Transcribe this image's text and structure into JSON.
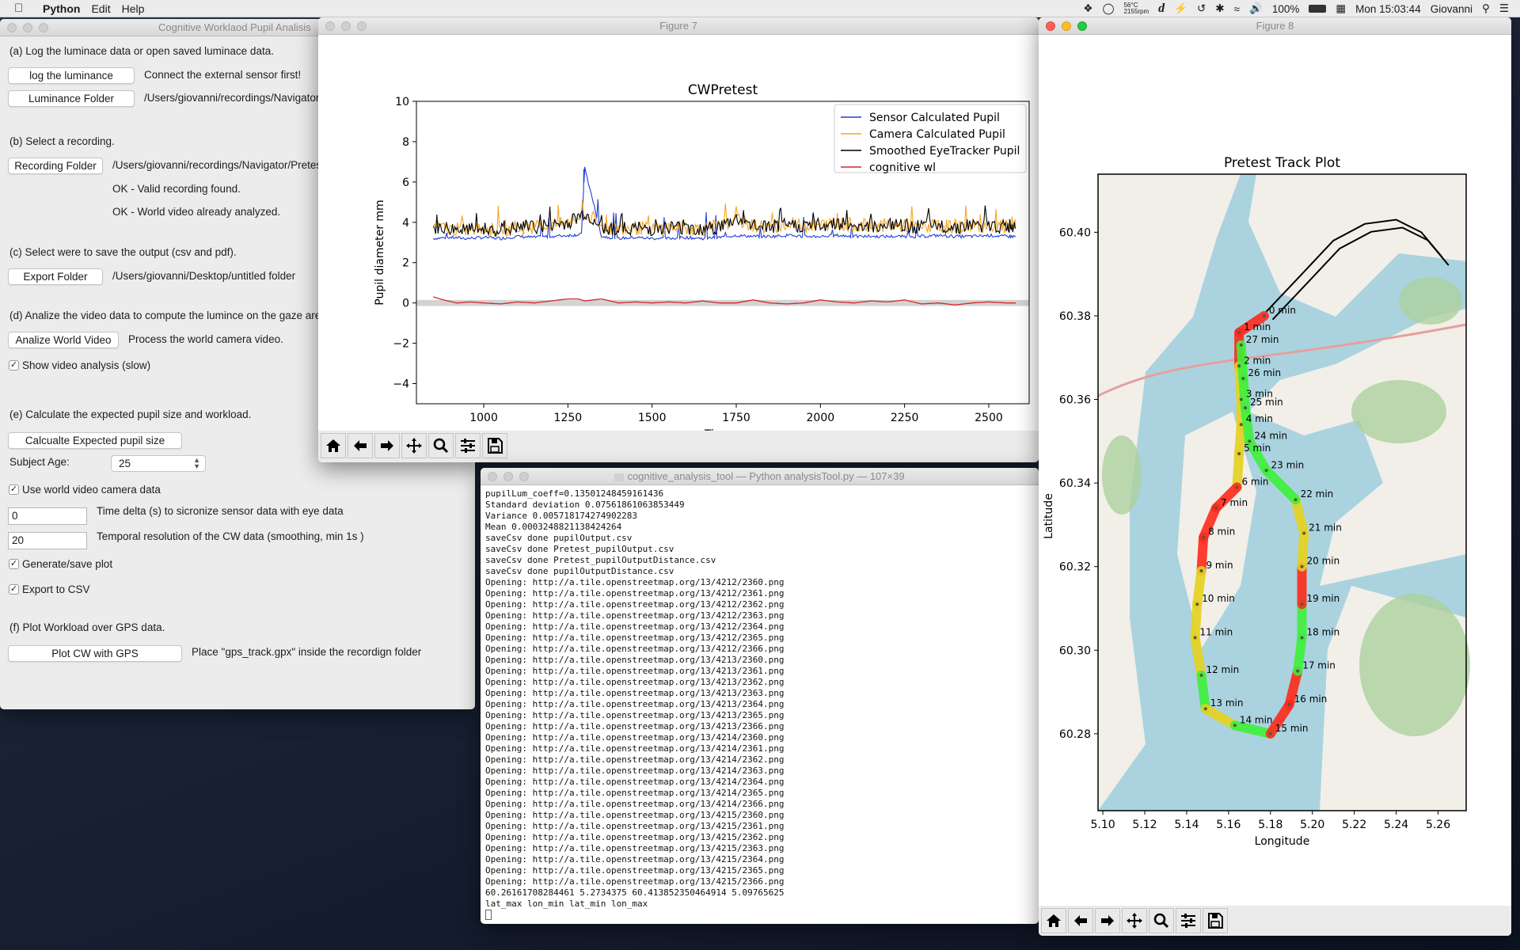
{
  "menubar": {
    "app": "Python",
    "items": [
      "Edit",
      "Help"
    ],
    "status": {
      "temp": "56°C",
      "rpm": "2155rpm",
      "battery": "100%",
      "clock": "Mon 15:03:44",
      "user": "Giovanni"
    }
  },
  "tool_window": {
    "title": "Cognitive Worklaod Pupil Analisis",
    "section_a": "(a) Log the luminace data or open saved luminace data.",
    "log_button": "log the luminance",
    "log_note": "Connect the external sensor first!",
    "lum_button": "Luminance Folder",
    "lum_path": "/Users/giovanni/recordings/Navigator",
    "section_b": "(b) Select a recording.",
    "rec_button": "Recording Folder",
    "rec_path": "/Users/giovanni/recordings/Navigator/Pretest",
    "rec_status1": "OK - Valid recording found.",
    "rec_status2": "OK - World video already analyzed.",
    "section_c": "(c) Select were to save the output (csv and pdf).",
    "export_button": "Export Folder",
    "export_path": "/Users/giovanni/Desktop/untitled folder",
    "section_d": "(d) Analize the video data to compute the lumince on the gaze area",
    "video_button": "Analize World Video",
    "video_note": "Process the world camera video.",
    "show_video_label": "Show video analysis (slow)",
    "show_video_checked": true,
    "section_e": "(e) Calculate the expected pupil size and workload.",
    "calc_button": "Calcualte Expected pupil size",
    "age_label": "Subject Age:",
    "age_value": "25",
    "use_world_label": "Use world video camera data",
    "use_world_checked": true,
    "time_delta_value": "0",
    "time_delta_label": "Time delta (s) to sicronize sensor data with eye data",
    "temporal_value": "20",
    "temporal_label": "Temporal resolution of the CW data (smoothing, min 1s )",
    "gen_plot_label": "Generate/save plot",
    "gen_plot_checked": true,
    "export_csv_label": "Export to CSV",
    "export_csv_checked": true,
    "section_f": "(f) Plot Workload over GPS data.",
    "gps_button": "Plot CW with GPS",
    "gps_note": "Place \"gps_track.gpx\" inside the recordign folder"
  },
  "figure7": {
    "title": "Figure 7",
    "toolbar": [
      "home-icon",
      "back-icon",
      "forward-icon",
      "pan-icon",
      "zoom-icon",
      "configure-icon",
      "save-icon"
    ]
  },
  "figure8": {
    "title": "Figure 8",
    "toolbar": [
      "home-icon",
      "back-icon",
      "forward-icon",
      "pan-icon",
      "zoom-icon",
      "configure-icon",
      "save-icon"
    ]
  },
  "terminal": {
    "title": "cognitive_analysis_tool — Python analysisTool.py — 107×39",
    "lines": [
      "pupilLum_coeff=0.13501248459161436",
      "Standard deviation 0.07561861063853449",
      "Variance 0.005718174274902283",
      "Mean 0.0003248821138424264",
      "saveCsv done pupilOutput.csv",
      "saveCsv done Pretest_pupilOutput.csv",
      "saveCsv done Pretest_pupilOutputDistance.csv",
      "saveCsv done pupilOutputDistance.csv",
      "Opening: http://a.tile.openstreetmap.org/13/4212/2360.png",
      "Opening: http://a.tile.openstreetmap.org/13/4212/2361.png",
      "Opening: http://a.tile.openstreetmap.org/13/4212/2362.png",
      "Opening: http://a.tile.openstreetmap.org/13/4212/2363.png",
      "Opening: http://a.tile.openstreetmap.org/13/4212/2364.png",
      "Opening: http://a.tile.openstreetmap.org/13/4212/2365.png",
      "Opening: http://a.tile.openstreetmap.org/13/4212/2366.png",
      "Opening: http://a.tile.openstreetmap.org/13/4213/2360.png",
      "Opening: http://a.tile.openstreetmap.org/13/4213/2361.png",
      "Opening: http://a.tile.openstreetmap.org/13/4213/2362.png",
      "Opening: http://a.tile.openstreetmap.org/13/4213/2363.png",
      "Opening: http://a.tile.openstreetmap.org/13/4213/2364.png",
      "Opening: http://a.tile.openstreetmap.org/13/4213/2365.png",
      "Opening: http://a.tile.openstreetmap.org/13/4213/2366.png",
      "Opening: http://a.tile.openstreetmap.org/13/4214/2360.png",
      "Opening: http://a.tile.openstreetmap.org/13/4214/2361.png",
      "Opening: http://a.tile.openstreetmap.org/13/4214/2362.png",
      "Opening: http://a.tile.openstreetmap.org/13/4214/2363.png",
      "Opening: http://a.tile.openstreetmap.org/13/4214/2364.png",
      "Opening: http://a.tile.openstreetmap.org/13/4214/2365.png",
      "Opening: http://a.tile.openstreetmap.org/13/4214/2366.png",
      "Opening: http://a.tile.openstreetmap.org/13/4215/2360.png",
      "Opening: http://a.tile.openstreetmap.org/13/4215/2361.png",
      "Opening: http://a.tile.openstreetmap.org/13/4215/2362.png",
      "Opening: http://a.tile.openstreetmap.org/13/4215/2363.png",
      "Opening: http://a.tile.openstreetmap.org/13/4215/2364.png",
      "Opening: http://a.tile.openstreetmap.org/13/4215/2365.png",
      "Opening: http://a.tile.openstreetmap.org/13/4215/2366.png",
      "60.26161708284461 5.2734375 60.413852350464914 5.09765625",
      "lat_max lon_min lat_min lon_max"
    ]
  },
  "colors": {
    "sensor": "#1f3fd6",
    "camera": "#f5a623",
    "smoothed": "#000000",
    "cognitive": "#d62728",
    "water": "#aad3df",
    "land": "#f2efe9",
    "forest": "#add19e"
  },
  "chart_data": [
    {
      "type": "line",
      "title": "CWPretest",
      "xlabel": "Time s",
      "ylabel": "Pupil diameter mm",
      "xlim": [
        800,
        2620
      ],
      "ylim": [
        -5,
        10
      ],
      "xticks": [
        1000,
        1250,
        1500,
        1750,
        2000,
        2250,
        2500
      ],
      "yticks": [
        -4,
        -2,
        0,
        2,
        4,
        6,
        8,
        10
      ],
      "legend_position": "top-right",
      "zero_band": 0,
      "series": [
        {
          "name": "Sensor Calculated Pupil",
          "color": "#1f3fd6",
          "x": [
            850,
            900,
            950,
            1000,
            1050,
            1100,
            1150,
            1200,
            1250,
            1290,
            1300,
            1350,
            1400,
            1450,
            1500,
            1550,
            1600,
            1650,
            1700,
            1750,
            1800,
            1850,
            1900,
            1950,
            2000,
            2050,
            2100,
            2150,
            2200,
            2250,
            2300,
            2350,
            2400,
            2450,
            2500,
            2550,
            2580
          ],
          "y": [
            3.2,
            3.25,
            3.2,
            3.25,
            3.2,
            3.3,
            3.25,
            3.3,
            3.35,
            3.4,
            6.7,
            3.3,
            3.2,
            3.25,
            3.2,
            3.2,
            3.25,
            3.2,
            3.25,
            3.35,
            3.3,
            3.3,
            3.35,
            3.3,
            3.3,
            3.35,
            3.3,
            3.3,
            3.3,
            3.3,
            3.3,
            3.35,
            3.3,
            3.3,
            3.35,
            3.3,
            3.3
          ]
        },
        {
          "name": "Camera Calculated Pupil",
          "color": "#f5a623",
          "x": [
            850,
            900,
            950,
            1000,
            1050,
            1100,
            1150,
            1200,
            1250,
            1300,
            1350,
            1400,
            1450,
            1500,
            1550,
            1600,
            1650,
            1700,
            1750,
            1800,
            1850,
            1900,
            1950,
            2000,
            2050,
            2100,
            2150,
            2200,
            2250,
            2300,
            2350,
            2400,
            2450,
            2500,
            2550,
            2580
          ],
          "y": [
            3.7,
            3.6,
            3.55,
            3.6,
            3.55,
            3.6,
            3.7,
            3.8,
            3.9,
            4.3,
            3.7,
            3.6,
            3.65,
            3.6,
            3.7,
            3.65,
            3.6,
            3.7,
            4.1,
            3.75,
            3.7,
            3.8,
            3.75,
            3.8,
            3.85,
            3.8,
            3.75,
            3.8,
            3.75,
            3.7,
            3.75,
            3.7,
            3.8,
            3.75,
            3.7,
            3.7
          ]
        },
        {
          "name": "Smoothed EyeTracker Pupil",
          "color": "#000000",
          "x": [
            850,
            900,
            950,
            1000,
            1050,
            1100,
            1150,
            1200,
            1250,
            1300,
            1350,
            1400,
            1450,
            1500,
            1550,
            1600,
            1650,
            1700,
            1750,
            1800,
            1850,
            1900,
            1950,
            2000,
            2050,
            2100,
            2150,
            2200,
            2250,
            2300,
            2350,
            2400,
            2450,
            2500,
            2550,
            2580
          ],
          "y": [
            3.7,
            3.6,
            3.55,
            3.6,
            3.55,
            3.65,
            3.7,
            3.8,
            3.9,
            4.4,
            3.7,
            3.6,
            3.65,
            3.6,
            3.7,
            3.65,
            3.6,
            3.7,
            4.1,
            3.75,
            3.7,
            3.8,
            3.75,
            3.8,
            3.9,
            3.8,
            3.75,
            3.8,
            3.75,
            3.7,
            3.75,
            3.7,
            3.8,
            3.75,
            3.7,
            3.7
          ]
        },
        {
          "name": "cognitive wl",
          "color": "#d62728",
          "x": [
            850,
            880,
            920,
            960,
            1000,
            1050,
            1100,
            1150,
            1200,
            1250,
            1280,
            1300,
            1350,
            1400,
            1450,
            1500,
            1550,
            1600,
            1650,
            1700,
            1750,
            1800,
            1850,
            1900,
            1950,
            2000,
            2050,
            2100,
            2150,
            2200,
            2250,
            2300,
            2350,
            2400,
            2450,
            2500,
            2550,
            2580
          ],
          "y": [
            0.3,
            0.15,
            0.0,
            0.05,
            0.0,
            -0.05,
            0.05,
            0.0,
            0.1,
            0.2,
            0.2,
            0.1,
            0.2,
            0.0,
            0.05,
            0.0,
            0.05,
            0.0,
            0.1,
            0.0,
            0.0,
            0.15,
            0.0,
            -0.05,
            0.0,
            0.15,
            0.05,
            0.0,
            0.1,
            0.05,
            0.15,
            -0.05,
            0.0,
            -0.1,
            0.0,
            0.05,
            0.0,
            0.0
          ]
        }
      ]
    },
    {
      "type": "scatter",
      "title": "Pretest Track Plot",
      "xlabel": "Longitude",
      "ylabel": "Latitude",
      "xlim": [
        5.0977,
        5.2734
      ],
      "ylim": [
        60.2616,
        60.4139
      ],
      "xticks": [
        "5.10",
        "5.12",
        "5.14",
        "5.16",
        "5.18",
        "5.20",
        "5.22",
        "5.24",
        "5.26"
      ],
      "yticks": [
        "60.28",
        "60.30",
        "60.32",
        "60.34",
        "60.36",
        "60.38",
        "60.40"
      ],
      "background": "OpenStreetMap tiles",
      "gps_track_extra": {
        "lon": [
          5.178,
          5.195,
          5.21,
          5.225,
          5.24,
          5.252,
          5.262
        ],
        "lat": [
          60.381,
          60.39,
          60.398,
          60.402,
          60.403,
          60.4,
          60.394
        ]
      },
      "track": [
        {
          "label": "0 min",
          "lon": 5.177,
          "lat": 60.38,
          "wl": "high"
        },
        {
          "label": "1 min",
          "lon": 5.165,
          "lat": 60.376,
          "wl": "high"
        },
        {
          "label": "27 min",
          "lon": 5.166,
          "lat": 60.373,
          "wl": "low"
        },
        {
          "label": "2 min",
          "lon": 5.165,
          "lat": 60.368,
          "wl": "mid"
        },
        {
          "label": "26 min",
          "lon": 5.167,
          "lat": 60.365,
          "wl": "low"
        },
        {
          "label": "3 min",
          "lon": 5.166,
          "lat": 60.36,
          "wl": "mid"
        },
        {
          "label": "25 min",
          "lon": 5.168,
          "lat": 60.358,
          "wl": "low"
        },
        {
          "label": "4 min",
          "lon": 5.166,
          "lat": 60.354,
          "wl": "mid"
        },
        {
          "label": "24 min",
          "lon": 5.17,
          "lat": 60.35,
          "wl": "low"
        },
        {
          "label": "5 min",
          "lon": 5.165,
          "lat": 60.347,
          "wl": "mid"
        },
        {
          "label": "23 min",
          "lon": 5.178,
          "lat": 60.343,
          "wl": "low"
        },
        {
          "label": "6 min",
          "lon": 5.164,
          "lat": 60.339,
          "wl": "high"
        },
        {
          "label": "22 min",
          "lon": 5.192,
          "lat": 60.336,
          "wl": "low"
        },
        {
          "label": "7 min",
          "lon": 5.154,
          "lat": 60.334,
          "wl": "high"
        },
        {
          "label": "21 min",
          "lon": 5.196,
          "lat": 60.328,
          "wl": "mid"
        },
        {
          "label": "8 min",
          "lon": 5.148,
          "lat": 60.327,
          "wl": "high"
        },
        {
          "label": "20 min",
          "lon": 5.195,
          "lat": 60.32,
          "wl": "mid"
        },
        {
          "label": "9 min",
          "lon": 5.147,
          "lat": 60.319,
          "wl": "mid"
        },
        {
          "label": "19 min",
          "lon": 5.195,
          "lat": 60.311,
          "wl": "high"
        },
        {
          "label": "10 min",
          "lon": 5.145,
          "lat": 60.311,
          "wl": "mid"
        },
        {
          "label": "18 min",
          "lon": 5.195,
          "lat": 60.303,
          "wl": "low"
        },
        {
          "label": "11 min",
          "lon": 5.144,
          "lat": 60.303,
          "wl": "mid"
        },
        {
          "label": "17 min",
          "lon": 5.193,
          "lat": 60.295,
          "wl": "low"
        },
        {
          "label": "12 min",
          "lon": 5.147,
          "lat": 60.294,
          "wl": "low"
        },
        {
          "label": "16 min",
          "lon": 5.189,
          "lat": 60.287,
          "wl": "high"
        },
        {
          "label": "13 min",
          "lon": 5.149,
          "lat": 60.286,
          "wl": "mid"
        },
        {
          "label": "14 min",
          "lon": 5.163,
          "lat": 60.282,
          "wl": "low"
        },
        {
          "label": "15 min",
          "lon": 5.18,
          "lat": 60.28,
          "wl": "high"
        }
      ]
    }
  ]
}
